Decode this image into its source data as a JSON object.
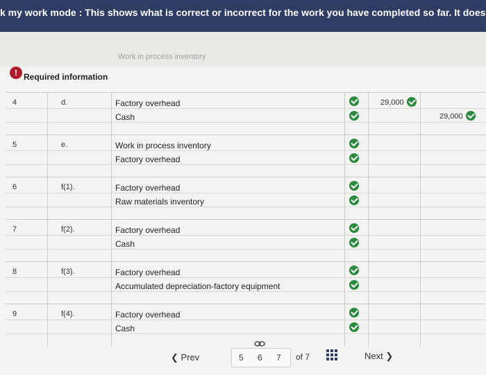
{
  "banner": {
    "text": "k my work mode : This shows what is correct or incorrect for the work you have completed so far. It does not indi"
  },
  "faded_header": {
    "text": "Work in process inventory"
  },
  "info": {
    "title": "Required information"
  },
  "rows": [
    {
      "no": "4",
      "event": "d.",
      "debit_account": "Factory overhead",
      "credit_account": "Cash",
      "debit_amount": "29,000",
      "credit_amount": "29,000"
    },
    {
      "no": "5",
      "event": "e.",
      "debit_account": "Work in process inventory",
      "credit_account": "Factory overhead",
      "debit_amount": "",
      "credit_amount": ""
    },
    {
      "no": "6",
      "event": "f(1).",
      "debit_account": "Factory overhead",
      "credit_account": "Raw materials inventory",
      "debit_amount": "",
      "credit_amount": ""
    },
    {
      "no": "7",
      "event": "f(2).",
      "debit_account": "Factory overhead",
      "credit_account": "Cash",
      "debit_amount": "",
      "credit_amount": ""
    },
    {
      "no": "8",
      "event": "f(3).",
      "debit_account": "Factory overhead",
      "credit_account": "Accumulated depreciation-factory equipment",
      "debit_amount": "",
      "credit_amount": ""
    },
    {
      "no": "9",
      "event": "f(4).",
      "debit_account": "Factory overhead",
      "credit_account": "Cash",
      "debit_amount": "",
      "credit_amount": ""
    }
  ],
  "pager": {
    "prev": "Prev",
    "pages": [
      "5",
      "6",
      "7"
    ],
    "current": "6",
    "of": "of 7",
    "next": "Next"
  },
  "colors": {
    "banner": "#2f3c63",
    "check": "#2b8a3e",
    "alert": "#b01b2e"
  }
}
